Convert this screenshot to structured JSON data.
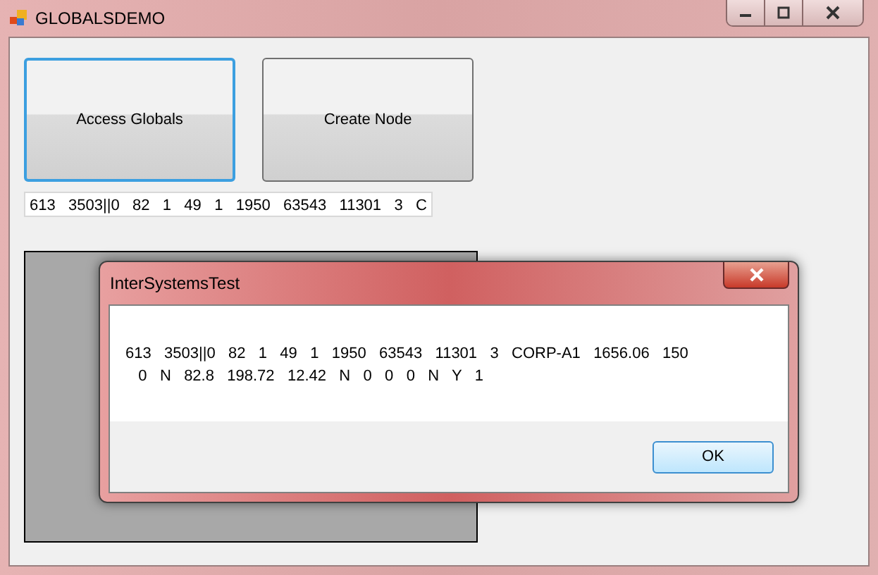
{
  "window": {
    "title": "GLOBALSDEMO"
  },
  "buttons": [
    {
      "label": "Access Globals",
      "focused": true
    },
    {
      "label": "Create Node",
      "focused": false
    }
  ],
  "textbox": {
    "value": "613   3503||0   82   1   49   1   1950   63543   11301   3   C"
  },
  "dialog": {
    "title": "InterSystemsTest",
    "lines": [
      "613   3503||0   82   1   49   1   1950   63543   11301   3   CORP-A1   1656.06   150",
      "   0   N   82.8   198.72   12.42   N   0   0   0   N   Y   1"
    ],
    "button": "OK"
  }
}
